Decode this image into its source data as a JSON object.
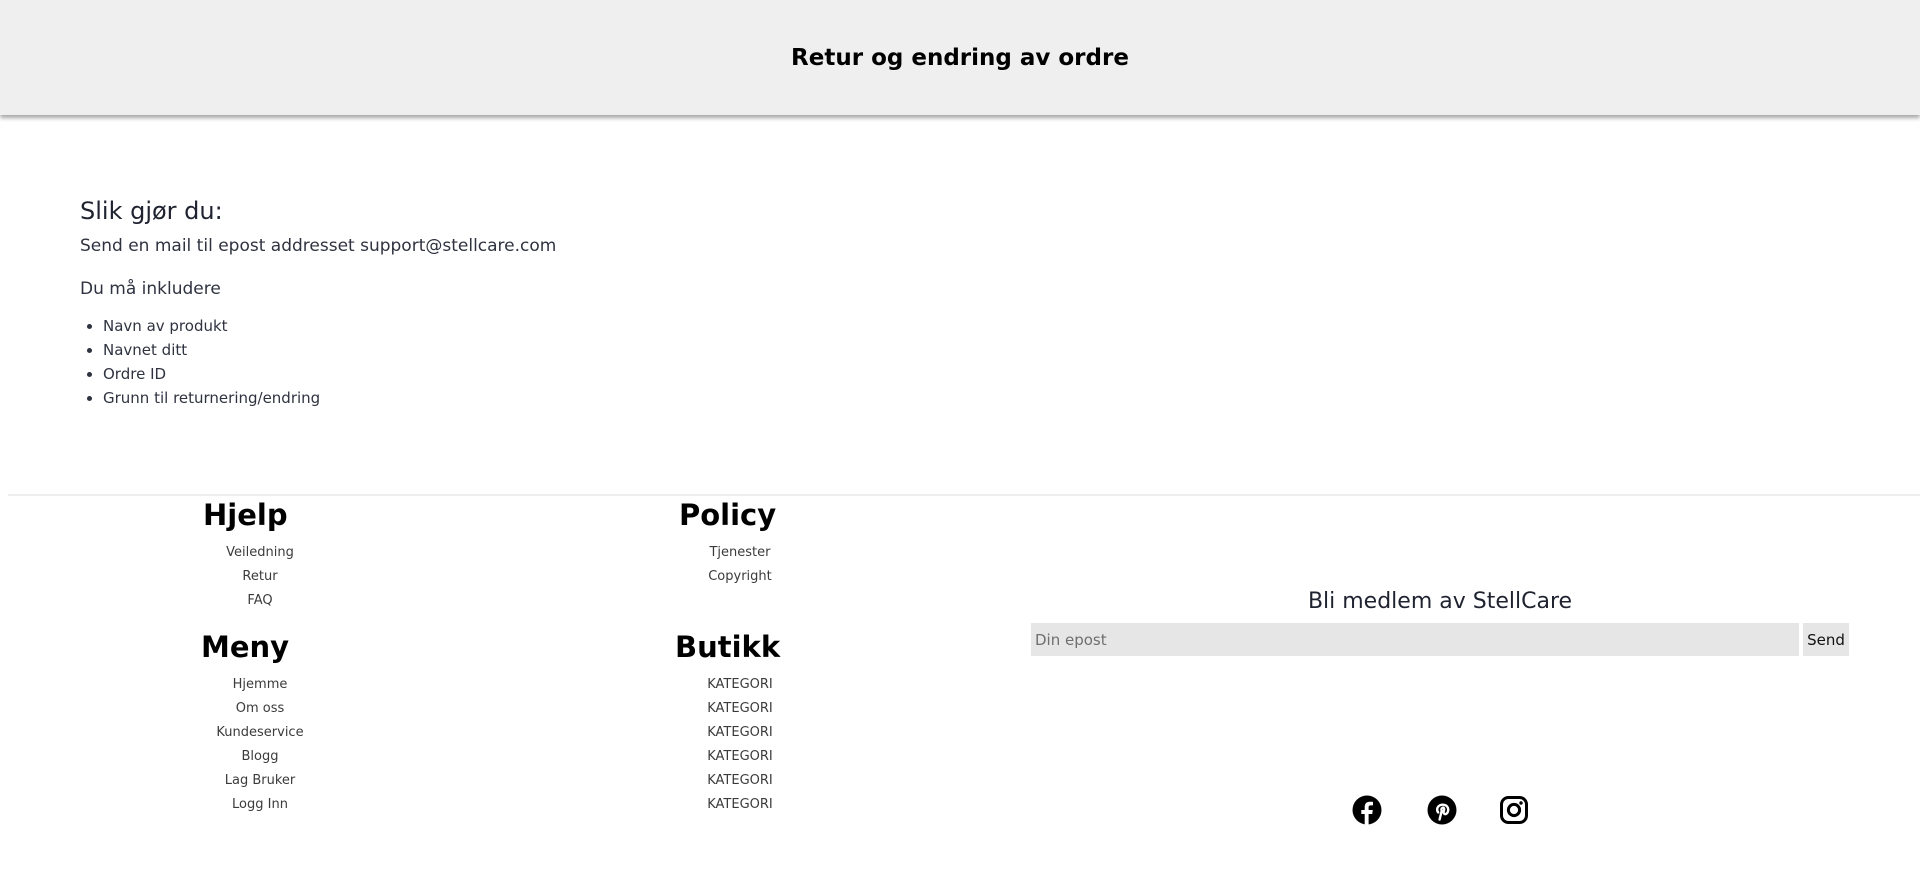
{
  "header": {
    "title": "Retur og endring av ordre"
  },
  "main": {
    "heading": "Slik gjør du:",
    "instruction": "Send en mail til epost addresset support@stellcare.com",
    "include_label": "Du må inkludere",
    "requirements": [
      "Navn av produkt",
      "Navnet ditt",
      "Ordre ID",
      "Grunn til returnering/endring"
    ]
  },
  "footer": {
    "help": {
      "title": "Hjelp",
      "links": [
        "Veiledning",
        "Retur",
        "FAQ"
      ]
    },
    "policy": {
      "title": "Policy",
      "links": [
        "Tjenester",
        "Copyright"
      ]
    },
    "menu": {
      "title": "Meny",
      "links": [
        "Hjemme",
        "Om oss",
        "Kundeservice",
        "Blogg",
        "Lag Bruker",
        "Logg Inn"
      ]
    },
    "shop": {
      "title": "Butikk",
      "links": [
        "KATEGORI",
        "KATEGORI",
        "KATEGORI",
        "KATEGORI",
        "KATEGORI",
        "KATEGORI"
      ]
    },
    "newsletter": {
      "title": "Bli medlem av StellCare",
      "placeholder": "Din epost",
      "send_label": "Send"
    },
    "social": [
      "facebook-icon",
      "pinterest-icon",
      "instagram-icon"
    ]
  }
}
